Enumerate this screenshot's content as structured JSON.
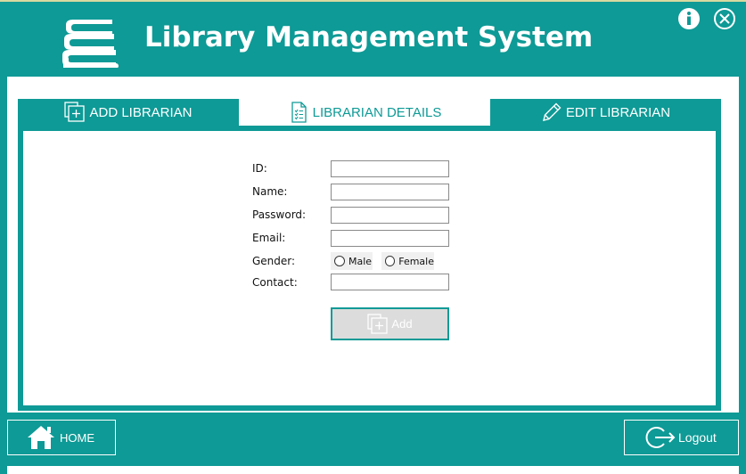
{
  "app": {
    "title": "Library Management System"
  },
  "window": {
    "info_icon": "info-icon",
    "close_icon": "close-icon"
  },
  "tabs": [
    {
      "label": "ADD LIBRARIAN",
      "icon": "add-document-icon",
      "active": false
    },
    {
      "label": "LIBRARIAN DETAILS",
      "icon": "checklist-icon",
      "active": true
    },
    {
      "label": "EDIT LIBRARIAN",
      "icon": "pencil-icon",
      "active": false
    }
  ],
  "form": {
    "id_label": "ID:",
    "id_value": "",
    "name_label": "Name:",
    "name_value": "",
    "password_label": "Password:",
    "password_value": "",
    "email_label": "Email:",
    "email_value": "",
    "gender_label": "Gender:",
    "gender_options": [
      "Male",
      "Female"
    ],
    "contact_label": "Contact:",
    "contact_value": "",
    "add_label": "Add"
  },
  "footer": {
    "home_label": "HOME",
    "logout_label": "Logout"
  },
  "colors": {
    "accent": "#0e9a96",
    "background": "#ffffff",
    "disabled_button": "#dcdcdc"
  }
}
